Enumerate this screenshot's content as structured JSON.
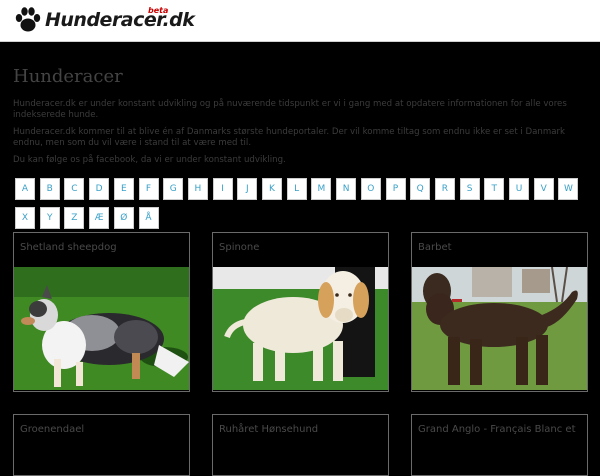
{
  "header": {
    "logo_text": "Hunderacer.dk",
    "beta_label": "beta",
    "paw_icon": "paw-icon"
  },
  "main": {
    "title": "Hunderacer",
    "paragraphs": [
      "Hunderacer.dk er under konstant udvikling og på nuværende tidspunkt er vi i gang med at opdatere informationen for alle vores indekserede hunde.",
      "Hunderacer.dk kommer til at blive én af Danmarks største hundeportaler. Der vil komme tiltag som endnu ikke er set i Danmark endnu, men som du vil være i stand til at være med til.",
      "Du kan følge os på facebook, da vi er under konstant udvikling."
    ],
    "letters": [
      "A",
      "B",
      "C",
      "D",
      "E",
      "F",
      "G",
      "H",
      "I",
      "J",
      "K",
      "L",
      "M",
      "N",
      "O",
      "P",
      "Q",
      "R",
      "S",
      "T",
      "U",
      "V",
      "W",
      "X",
      "Y",
      "Z",
      "Æ",
      "Ø",
      "Å"
    ],
    "breeds": [
      {
        "name": "Shetland sheepdog"
      },
      {
        "name": "Spinone"
      },
      {
        "name": "Barbet"
      },
      {
        "name": "Groenendael"
      },
      {
        "name": "Ruhåret Hønsehund"
      },
      {
        "name": "Grand Anglo - Français Blanc et"
      }
    ]
  },
  "colors": {
    "background": "#000000",
    "letter_text": "#3aa0c8",
    "beta": "#cc0000"
  }
}
